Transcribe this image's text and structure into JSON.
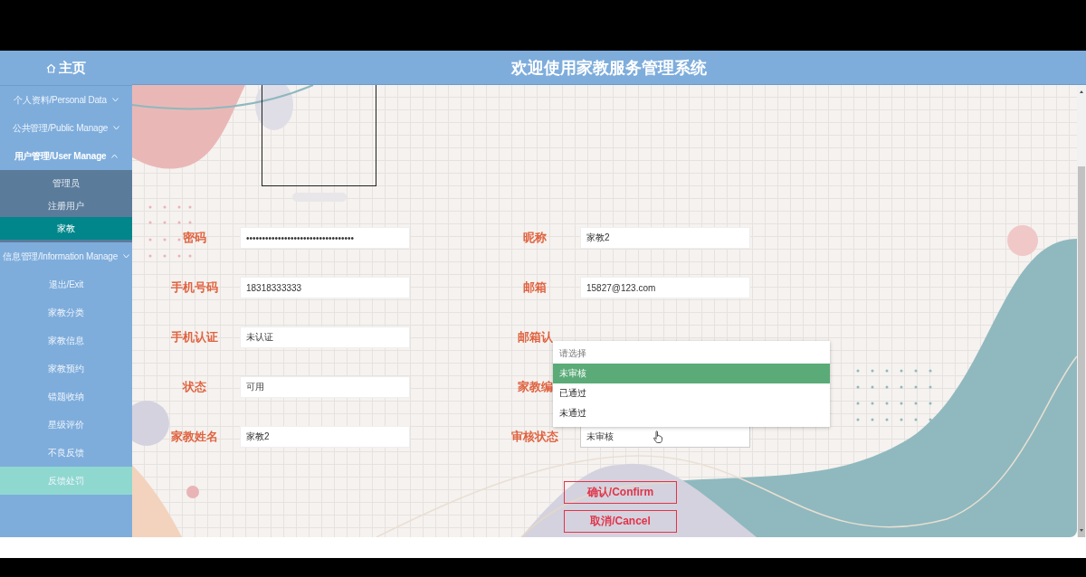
{
  "sidebar": {
    "home": "主页",
    "items": [
      {
        "label": "个人资料/Personal Data",
        "kind": "group",
        "expanded": false,
        "hovered": false
      },
      {
        "label": "公共管理/Public Manage",
        "kind": "group",
        "expanded": false,
        "hovered": false
      },
      {
        "label": "用户管理/User Manage",
        "kind": "group",
        "expanded": true,
        "hovered": false,
        "children": [
          {
            "label": "管理员",
            "selected": false
          },
          {
            "label": "注册用户",
            "selected": false
          },
          {
            "label": "家教",
            "selected": true
          }
        ]
      },
      {
        "label": "信息管理/Information Manage",
        "kind": "group",
        "expanded": false,
        "hovered": false
      },
      {
        "label": "退出/Exit",
        "kind": "link",
        "hovered": false
      },
      {
        "label": "家教分类",
        "kind": "link",
        "hovered": false
      },
      {
        "label": "家教信息",
        "kind": "link",
        "hovered": false
      },
      {
        "label": "家教预约",
        "kind": "link",
        "hovered": false
      },
      {
        "label": "错题收纳",
        "kind": "link",
        "hovered": false
      },
      {
        "label": "星级评价",
        "kind": "link",
        "hovered": false
      },
      {
        "label": "不良反馈",
        "kind": "link",
        "hovered": false
      },
      {
        "label": "反馈处罚",
        "kind": "link",
        "hovered": true
      }
    ]
  },
  "header": {
    "title": "欢迎使用家教服务管理系统"
  },
  "form": {
    "fields": [
      {
        "label": "密码",
        "value": "••••••••••••••••••••••••••••••••••",
        "kind": "text"
      },
      {
        "label": "昵称",
        "value": "家教2",
        "kind": "text"
      },
      {
        "label": "手机号码",
        "value": "18318333333",
        "kind": "text"
      },
      {
        "label": "邮箱",
        "value": "15827@123.com",
        "kind": "text"
      },
      {
        "label": "手机认证",
        "value": "未认证",
        "kind": "text"
      },
      {
        "label": "邮箱认"
      },
      {
        "label": "状态",
        "value": "可用",
        "kind": "text"
      },
      {
        "label": "家教编"
      },
      {
        "label": "家教姓名",
        "value": "家教2",
        "kind": "text"
      },
      {
        "label": "审核状态",
        "value": "未审核",
        "kind": "select"
      }
    ],
    "dropdown": {
      "placeholder": "请选择",
      "options": [
        {
          "label": "未审核",
          "selected": true
        },
        {
          "label": "已通过",
          "selected": false
        },
        {
          "label": "未通过",
          "selected": false
        }
      ]
    },
    "buttons": [
      {
        "label": "确认/Confirm"
      },
      {
        "label": "取消/Cancel"
      }
    ]
  }
}
